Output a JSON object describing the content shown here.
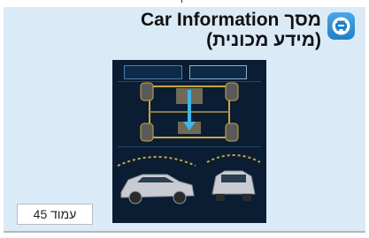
{
  "header": {
    "title_line1": "מסך Car Information",
    "title_line2": "(מידע מכונית)",
    "icon": "car-info-icon"
  },
  "screen": {
    "description_icon_names": [
      "chassis-diagram-icon",
      "car-side-view-icon",
      "car-rear-view-icon"
    ]
  },
  "footer": {
    "page_label": "עמוד 45"
  },
  "colors": {
    "card_background": "#dbeaf7",
    "icon_blue": "#1f7fc9",
    "screen_background": "#0a1d33",
    "diagram_yellow": "#c9a83a",
    "diagram_cyan": "#3fb6e8"
  }
}
